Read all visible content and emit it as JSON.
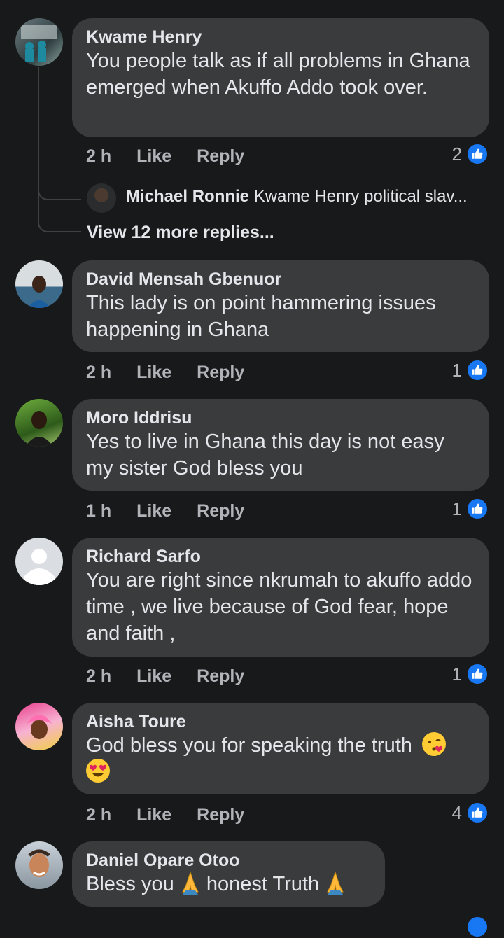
{
  "comments": [
    {
      "author": "Kwame Henry",
      "text": "You people talk as if all problems in Ghana emerged when Akuffo Addo took over.",
      "time": "2 h",
      "like": "Like",
      "reply": "Reply",
      "reactions": "2",
      "reply_preview": {
        "author": "Michael Ronnie",
        "text": "Kwame Henry political slav..."
      },
      "view_more": "View 12 more replies..."
    },
    {
      "author": "David Mensah Gbenuor",
      "text": "This lady is on point hammering issues happening in Ghana",
      "time": "2 h",
      "like": "Like",
      "reply": "Reply",
      "reactions": "1"
    },
    {
      "author": "Moro Iddrisu",
      "text": "Yes to live in Ghana this day is not easy my sister God bless you",
      "time": "1 h",
      "like": "Like",
      "reply": "Reply",
      "reactions": "1"
    },
    {
      "author": "Richard Sarfo",
      "text": "You are right since nkrumah to akuffo addo time , we live because of God fear, hope and faith ,",
      "time": "2 h",
      "like": "Like",
      "reply": "Reply",
      "reactions": "1"
    },
    {
      "author": "Aisha Toure",
      "text": "God bless you for speaking the truth",
      "time": "2 h",
      "like": "Like",
      "reply": "Reply",
      "reactions": "4"
    },
    {
      "author": "Daniel Opare Otoo",
      "text_a": "Bless you",
      "text_b": "honest Truth"
    }
  ],
  "colors": {
    "background": "#18191a",
    "bubble": "#3a3b3c",
    "like_blue": "#1877f2",
    "secondary_text": "#b0b3b8"
  },
  "icons": [
    "thumbs-up-icon",
    "kissing-heart-emoji",
    "heart-eyes-emoji",
    "folded-hands-emoji"
  ]
}
